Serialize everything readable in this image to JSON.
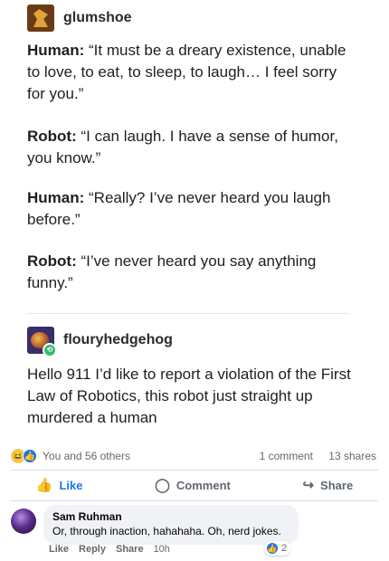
{
  "posts": [
    {
      "username": "glumshoe",
      "lines": [
        {
          "speaker": "Human:",
          "text": " “It must be a dreary existence, unable to love, to eat, to sleep, to laugh… I feel sorry for you.”"
        },
        {
          "speaker": "Robot:",
          "text": " “I can laugh. I have a sense of humor, you know.”"
        },
        {
          "speaker": "Human:",
          "text": " “Really? I’ve never heard you laugh before.”"
        },
        {
          "speaker": "Robot:",
          "text": " “I’ve never heard you say anything funny.”"
        }
      ]
    },
    {
      "username": "flouryhedgehog",
      "text": "Hello 911 I’d like to report a violation of the First Law of Robotics, this robot just straight up murdered a human"
    }
  ],
  "facebook": {
    "reactions_text": "You and 56 others",
    "comments_count": "1 comment",
    "shares_count": "13 shares",
    "actions": {
      "like": "Like",
      "comment": "Comment",
      "share": "Share"
    },
    "comment": {
      "author": "Sam Ruhman",
      "text": "Or, through inaction, hahahaha. Oh, nerd jokes.",
      "reaction_count": "2",
      "meta": {
        "like": "Like",
        "reply": "Reply",
        "share": "Share",
        "time": "10h"
      }
    },
    "colors": {
      "accent": "#1877f2",
      "muted": "#65676b"
    }
  },
  "icons": {
    "haha": "haha-emoji-icon",
    "like": "thumbs-up-icon",
    "comment": "speech-bubble-icon",
    "share": "share-arrow-icon",
    "reblog": "reblog-icon"
  }
}
